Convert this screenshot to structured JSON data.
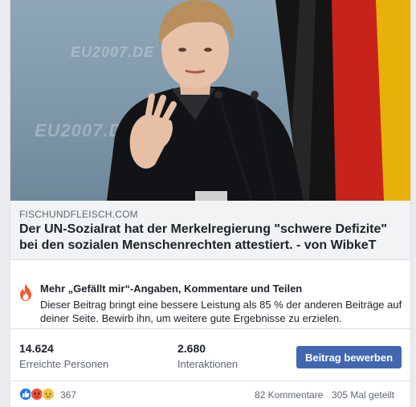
{
  "post": {
    "domain": "FISCHUNDFLEISCH.COM",
    "headline": "Der UN-Sozialrat hat der Merkelregierung \"schwere Defizite\" bei den sozialen Menschenrechten attestiert. - von WibkeT",
    "watermark": "EU2007.DE"
  },
  "notice": {
    "title": "Mehr „Gefällt mir“-Angaben, Kommentare und Teilen",
    "body": "Dieser Beitrag bringt eine bessere Leistung als 85 % der anderen Beiträge auf deiner Seite. Bewirb ihn, um weitere gute Ergebnisse zu erzielen."
  },
  "stats": {
    "reach_value": "14.624",
    "reach_label": "Erreichte Personen",
    "interactions_value": "2.680",
    "interactions_label": "Interaktionen",
    "boost_label": "Beitrag bewerben"
  },
  "footer": {
    "reaction_count": "367",
    "comments": "82 Kommentare",
    "shares": "305 Mal geteilt",
    "reactions": [
      "like-icon",
      "angry-icon",
      "sad-icon"
    ]
  },
  "colors": {
    "accent": "#4267b2",
    "flag_black": "#141414",
    "flag_red": "#c8231b",
    "flag_gold": "#e7b10a"
  }
}
